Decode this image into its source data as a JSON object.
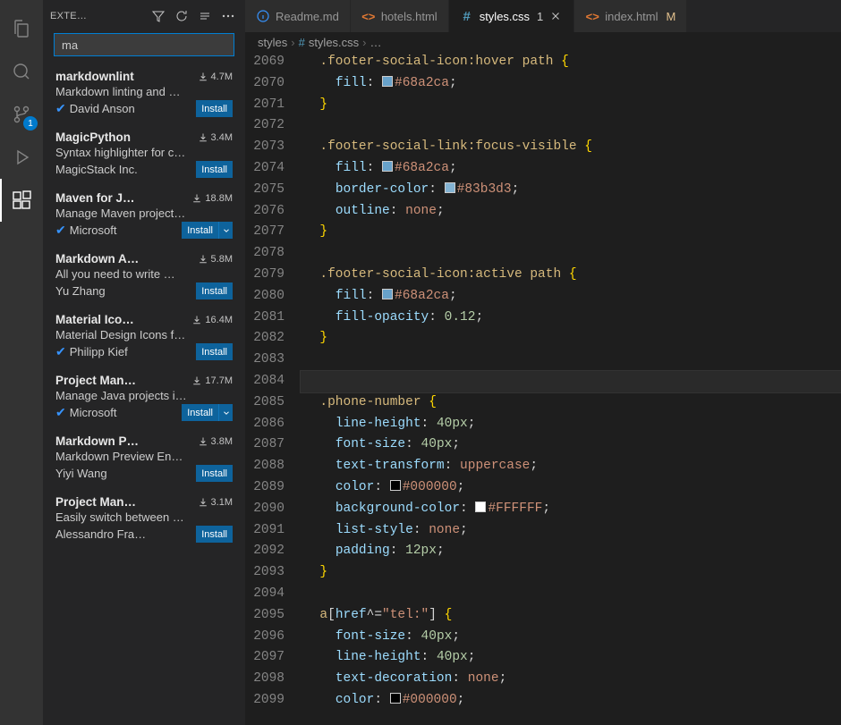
{
  "activity": {
    "scm_badge": "1"
  },
  "sidebar": {
    "title": "EXTE…",
    "search_value": "ma",
    "extensions": [
      {
        "name": "markdownlint",
        "downloads": "4.7M",
        "desc": "Markdown linting and …",
        "publisher": "David Anson",
        "verified": true,
        "action": "Install",
        "split": false
      },
      {
        "name": "MagicPython",
        "downloads": "3.4M",
        "desc": "Syntax highlighter for c…",
        "publisher": "MagicStack Inc.",
        "verified": false,
        "action": "Install",
        "split": false
      },
      {
        "name": "Maven for J…",
        "downloads": "18.8M",
        "desc": "Manage Maven project…",
        "publisher": "Microsoft",
        "verified": true,
        "action": "Install",
        "split": true
      },
      {
        "name": "Markdown A…",
        "downloads": "5.8M",
        "desc": "All you need to write …",
        "publisher": "Yu Zhang",
        "verified": false,
        "action": "Install",
        "split": false
      },
      {
        "name": "Material Ico…",
        "downloads": "16.4M",
        "desc": "Material Design Icons f…",
        "publisher": "Philipp Kief",
        "verified": true,
        "action": "Install",
        "split": false
      },
      {
        "name": "Project Man…",
        "downloads": "17.7M",
        "desc": "Manage Java projects i…",
        "publisher": "Microsoft",
        "verified": true,
        "action": "Install",
        "split": true
      },
      {
        "name": "Markdown P…",
        "downloads": "3.8M",
        "desc": "Markdown Preview En…",
        "publisher": "Yiyi Wang",
        "verified": false,
        "action": "Install",
        "split": false
      },
      {
        "name": "Project Man…",
        "downloads": "3.1M",
        "desc": "Easily switch between …",
        "publisher": "Alessandro Fra…",
        "verified": false,
        "action": "Install",
        "split": false
      }
    ]
  },
  "tabs": [
    {
      "icon": "info",
      "label": "Readme.md",
      "modified": "",
      "active": false
    },
    {
      "icon": "html",
      "label": "hotels.html",
      "modified": "",
      "active": false
    },
    {
      "icon": "css",
      "label": "styles.css",
      "modified": "1",
      "active": true
    },
    {
      "icon": "html",
      "label": "index.html",
      "modified": "M",
      "active": false
    }
  ],
  "breadcrumbs": {
    "folder": "styles",
    "file": "styles.css",
    "symbol": "…"
  },
  "code": {
    "startLine": 2069,
    "lines": [
      {
        "segs": [
          [
            "sp",
            "  "
          ],
          [
            "sel",
            ".footer-social-icon:hover"
          ],
          [
            "sp",
            " "
          ],
          [
            "sel",
            "path"
          ],
          [
            "sp",
            " "
          ],
          [
            "brace",
            "{"
          ]
        ]
      },
      {
        "segs": [
          [
            "sp",
            "    "
          ],
          [
            "prop",
            "fill"
          ],
          [
            "punct",
            ":"
          ],
          [
            "sp",
            " "
          ],
          [
            "sw",
            "#68a2ca"
          ],
          [
            "val",
            "#68a2ca"
          ],
          [
            "punct",
            ";"
          ]
        ]
      },
      {
        "segs": [
          [
            "sp",
            "  "
          ],
          [
            "brace",
            "}"
          ]
        ]
      },
      {
        "segs": []
      },
      {
        "segs": [
          [
            "sp",
            "  "
          ],
          [
            "sel",
            ".footer-social-link:focus-visible"
          ],
          [
            "sp",
            " "
          ],
          [
            "brace",
            "{"
          ]
        ]
      },
      {
        "segs": [
          [
            "sp",
            "    "
          ],
          [
            "prop",
            "fill"
          ],
          [
            "punct",
            ":"
          ],
          [
            "sp",
            " "
          ],
          [
            "sw",
            "#68a2ca"
          ],
          [
            "val",
            "#68a2ca"
          ],
          [
            "punct",
            ";"
          ]
        ]
      },
      {
        "segs": [
          [
            "sp",
            "    "
          ],
          [
            "prop",
            "border-color"
          ],
          [
            "punct",
            ":"
          ],
          [
            "sp",
            " "
          ],
          [
            "sw",
            "#83b3d3"
          ],
          [
            "val",
            "#83b3d3"
          ],
          [
            "punct",
            ";"
          ]
        ]
      },
      {
        "segs": [
          [
            "sp",
            "    "
          ],
          [
            "prop",
            "outline"
          ],
          [
            "punct",
            ":"
          ],
          [
            "sp",
            " "
          ],
          [
            "none",
            "none"
          ],
          [
            "punct",
            ";"
          ]
        ]
      },
      {
        "segs": [
          [
            "sp",
            "  "
          ],
          [
            "brace",
            "}"
          ]
        ]
      },
      {
        "segs": []
      },
      {
        "segs": [
          [
            "sp",
            "  "
          ],
          [
            "sel",
            ".footer-social-icon:active"
          ],
          [
            "sp",
            " "
          ],
          [
            "sel",
            "path"
          ],
          [
            "sp",
            " "
          ],
          [
            "brace",
            "{"
          ]
        ]
      },
      {
        "segs": [
          [
            "sp",
            "    "
          ],
          [
            "prop",
            "fill"
          ],
          [
            "punct",
            ":"
          ],
          [
            "sp",
            " "
          ],
          [
            "sw",
            "#68a2ca"
          ],
          [
            "val",
            "#68a2ca"
          ],
          [
            "punct",
            ";"
          ]
        ]
      },
      {
        "segs": [
          [
            "sp",
            "    "
          ],
          [
            "prop",
            "fill-opacity"
          ],
          [
            "punct",
            ":"
          ],
          [
            "sp",
            " "
          ],
          [
            "num",
            "0.12"
          ],
          [
            "punct",
            ";"
          ]
        ]
      },
      {
        "segs": [
          [
            "sp",
            "  "
          ],
          [
            "brace",
            "}"
          ]
        ]
      },
      {
        "segs": []
      },
      {
        "current": true,
        "segs": []
      },
      {
        "segs": [
          [
            "sp",
            "  "
          ],
          [
            "sel",
            ".phone-number"
          ],
          [
            "sp",
            " "
          ],
          [
            "brace",
            "{"
          ]
        ]
      },
      {
        "segs": [
          [
            "sp",
            "    "
          ],
          [
            "prop",
            "line-height"
          ],
          [
            "punct",
            ":"
          ],
          [
            "sp",
            " "
          ],
          [
            "num",
            "40px"
          ],
          [
            "punct",
            ";"
          ]
        ]
      },
      {
        "segs": [
          [
            "sp",
            "    "
          ],
          [
            "prop",
            "font-size"
          ],
          [
            "punct",
            ":"
          ],
          [
            "sp",
            " "
          ],
          [
            "num",
            "40px"
          ],
          [
            "punct",
            ";"
          ]
        ]
      },
      {
        "segs": [
          [
            "sp",
            "    "
          ],
          [
            "prop",
            "text-transform"
          ],
          [
            "punct",
            ":"
          ],
          [
            "sp",
            " "
          ],
          [
            "none",
            "uppercase"
          ],
          [
            "punct",
            ";"
          ]
        ]
      },
      {
        "segs": [
          [
            "sp",
            "    "
          ],
          [
            "prop",
            "color"
          ],
          [
            "punct",
            ":"
          ],
          [
            "sp",
            " "
          ],
          [
            "sw",
            "#000000"
          ],
          [
            "val",
            "#000000"
          ],
          [
            "punct",
            ";"
          ]
        ]
      },
      {
        "segs": [
          [
            "sp",
            "    "
          ],
          [
            "prop",
            "background-color"
          ],
          [
            "punct",
            ":"
          ],
          [
            "sp",
            " "
          ],
          [
            "sw",
            "#FFFFFF"
          ],
          [
            "val",
            "#FFFFFF"
          ],
          [
            "punct",
            ";"
          ]
        ]
      },
      {
        "segs": [
          [
            "sp",
            "    "
          ],
          [
            "prop",
            "list-style"
          ],
          [
            "punct",
            ":"
          ],
          [
            "sp",
            " "
          ],
          [
            "none",
            "none"
          ],
          [
            "punct",
            ";"
          ]
        ]
      },
      {
        "segs": [
          [
            "sp",
            "    "
          ],
          [
            "prop",
            "padding"
          ],
          [
            "punct",
            ":"
          ],
          [
            "sp",
            " "
          ],
          [
            "num",
            "12px"
          ],
          [
            "punct",
            ";"
          ]
        ]
      },
      {
        "segs": [
          [
            "sp",
            "  "
          ],
          [
            "brace",
            "}"
          ]
        ]
      },
      {
        "segs": []
      },
      {
        "segs": [
          [
            "sp",
            "  "
          ],
          [
            "sel",
            "a"
          ],
          [
            "punct",
            "["
          ],
          [
            "prop",
            "href"
          ],
          [
            "punct",
            "^="
          ],
          [
            "val",
            "\"tel:\""
          ],
          [
            "punct",
            "]"
          ],
          [
            "sp",
            " "
          ],
          [
            "brace",
            "{"
          ]
        ]
      },
      {
        "segs": [
          [
            "sp",
            "    "
          ],
          [
            "prop",
            "font-size"
          ],
          [
            "punct",
            ":"
          ],
          [
            "sp",
            " "
          ],
          [
            "num",
            "40px"
          ],
          [
            "punct",
            ";"
          ]
        ]
      },
      {
        "segs": [
          [
            "sp",
            "    "
          ],
          [
            "prop",
            "line-height"
          ],
          [
            "punct",
            ":"
          ],
          [
            "sp",
            " "
          ],
          [
            "num",
            "40px"
          ],
          [
            "punct",
            ";"
          ]
        ]
      },
      {
        "segs": [
          [
            "sp",
            "    "
          ],
          [
            "prop",
            "text-decoration"
          ],
          [
            "punct",
            ":"
          ],
          [
            "sp",
            " "
          ],
          [
            "none",
            "none"
          ],
          [
            "punct",
            ";"
          ]
        ]
      },
      {
        "segs": [
          [
            "sp",
            "    "
          ],
          [
            "prop",
            "color"
          ],
          [
            "punct",
            ":"
          ],
          [
            "sp",
            " "
          ],
          [
            "sw",
            "#000000"
          ],
          [
            "val",
            "#000000"
          ],
          [
            "punct",
            ";"
          ]
        ]
      }
    ]
  }
}
